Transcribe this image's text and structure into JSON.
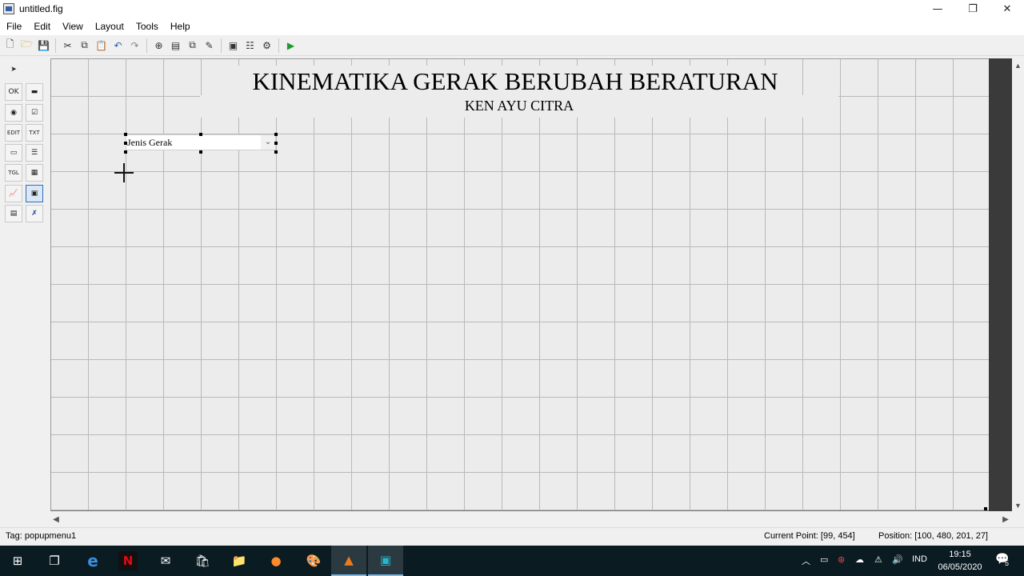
{
  "window": {
    "title": "untitled.fig",
    "minimize_glyph": "—",
    "maximize_glyph": "❐",
    "close_glyph": "✕"
  },
  "menu": [
    "File",
    "Edit",
    "View",
    "Layout",
    "Tools",
    "Help"
  ],
  "toolbar": {
    "icons": [
      "new-file-icon",
      "open-file-icon",
      "save-icon",
      "cut-icon",
      "copy-icon",
      "paste-icon",
      "undo-icon",
      "redo-icon",
      "align-objects-icon",
      "menu-editor-icon",
      "tab-order-editor-icon",
      "toolbar-editor-icon",
      "editor-icon",
      "property-inspector-icon",
      "object-browser-icon",
      "run-figure-icon"
    ]
  },
  "palette": {
    "items": [
      {
        "name": "select-tool-icon",
        "glyph": "➤"
      },
      {
        "name": "push-button-tool-icon",
        "glyph": "OK"
      },
      {
        "name": "slider-tool-icon",
        "glyph": "▬"
      },
      {
        "name": "radio-button-tool-icon",
        "glyph": "◉"
      },
      {
        "name": "checkbox-tool-icon",
        "glyph": "☑"
      },
      {
        "name": "edit-text-tool-icon",
        "glyph": "EDIT"
      },
      {
        "name": "static-text-tool-icon",
        "glyph": "TXT"
      },
      {
        "name": "popup-menu-tool-icon",
        "glyph": "▭"
      },
      {
        "name": "listbox-tool-icon",
        "glyph": "☰"
      },
      {
        "name": "toggle-button-tool-icon",
        "glyph": "TGL"
      },
      {
        "name": "table-tool-icon",
        "glyph": "▦"
      },
      {
        "name": "axes-tool-icon",
        "glyph": "📈"
      },
      {
        "name": "panel-tool-icon",
        "glyph": "▣"
      },
      {
        "name": "button-group-tool-icon",
        "glyph": "▤"
      },
      {
        "name": "activex-control-tool-icon",
        "glyph": "✗"
      }
    ]
  },
  "canvas": {
    "title": "KINEMATIKA GERAK BERUBAH BERATURAN",
    "subtitle": "KEN AYU CITRA",
    "popup": {
      "label": "Jenis Gerak",
      "caret": "⌄"
    }
  },
  "scroll": {
    "up": "▲",
    "down": "▼",
    "left": "◀",
    "right": "▶"
  },
  "status": {
    "tag": "Tag: popupmenu1",
    "current_point": "Current Point:  [99, 454]",
    "position": "Position: [100, 480, 201, 27]"
  },
  "taskbar": {
    "tray_language": "IND",
    "time": "19:15",
    "date": "06/05/2020",
    "notification_count": "5"
  }
}
